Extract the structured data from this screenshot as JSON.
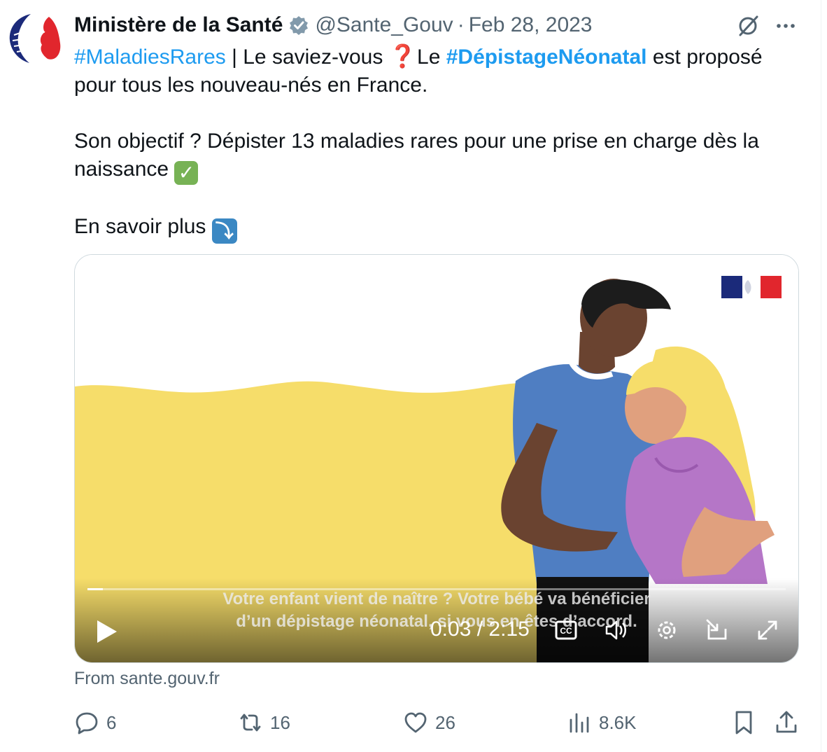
{
  "tweet": {
    "author_name": "Ministère de la Santé",
    "handle": "@Sante_Gouv",
    "separator": "·",
    "date": "Feb 28, 2023",
    "line1": {
      "hashtag1": "#MaladiesRares",
      "text1": " | Le saviez-vous ",
      "emoji_q": "❓",
      "text2": " Le ",
      "hashtag2": "#DépistageNéonatal",
      "text3": " est proposé pour tous les nouveau-nés en France."
    },
    "para2": "Son objectif ? Dépister 13 maladies rares pour une prise en charge dès la naissance ",
    "emoji_check": "✓",
    "para3": "En savoir plus ",
    "emoji_arrow": "⤵"
  },
  "video": {
    "subtitle_line1": "Votre enfant vient de naître ? Votre bébé va bénéficier",
    "subtitle_line2": "d’un dépistage néonatal, si vous en êtes d’accord.",
    "current_time": "0:03",
    "time_separator": " / ",
    "duration": "2:15",
    "progress": 0.022
  },
  "source": "From sante.gouv.fr",
  "actions": {
    "replies": "6",
    "reposts": "16",
    "likes": "26",
    "views": "8.6K"
  },
  "colors": {
    "accent": "#1d9bf0",
    "secondary_text": "#536471",
    "video_yellow": "#f6dd6a"
  },
  "icons": [
    "avatar-logo",
    "verified-badge-icon",
    "grok-icon",
    "more-icon",
    "play-icon",
    "cc-icon",
    "volume-icon",
    "settings-icon",
    "popout-icon",
    "fullscreen-icon",
    "reply-icon",
    "repost-icon",
    "like-icon",
    "views-icon",
    "bookmark-icon",
    "share-icon"
  ]
}
